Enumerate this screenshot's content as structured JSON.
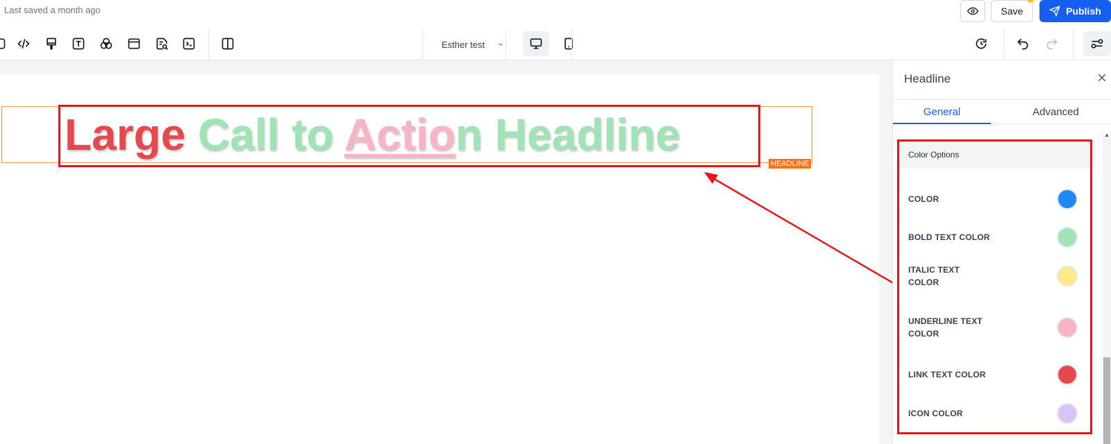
{
  "topbar": {
    "saved_status": "Last saved a month ago",
    "save_label": "Save",
    "publish_label": "Publish",
    "font_select_value": "Esther test"
  },
  "canvas": {
    "headline": {
      "word1": "Large",
      "word2": "Call to",
      "word3": "Actio",
      "word4": "n Headline"
    },
    "element_tag": "HEADLINE"
  },
  "panel": {
    "title": "Headline",
    "tabs": [
      {
        "label": "General"
      },
      {
        "label": "Advanced"
      }
    ],
    "section_title": "Color Options",
    "colors": [
      {
        "label_line1": "COLOR",
        "label_line2": "",
        "hex": "#1e88f5"
      },
      {
        "label_line1": "BOLD TEXT COLOR",
        "label_line2": "",
        "hex": "#a0e4b6"
      },
      {
        "label_line1": "ITALIC TEXT",
        "label_line2": "COLOR",
        "hex": "#fdeb87"
      },
      {
        "label_line1": "UNDERLINE TEXT",
        "label_line2": "COLOR",
        "hex": "#f7b4c4"
      },
      {
        "label_line1": "LINK TEXT COLOR",
        "label_line2": "",
        "hex": "#e5484d"
      },
      {
        "label_line1": "ICON COLOR",
        "label_line2": "",
        "hex": "#d9c4fa"
      }
    ]
  },
  "theme": {
    "accent": "#155eef",
    "highlight_red": "#e8141a",
    "element_orange": "#f97316"
  }
}
